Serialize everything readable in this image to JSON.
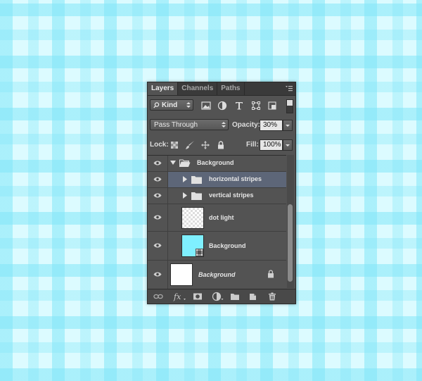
{
  "tabs": [
    {
      "label": "Layers",
      "active": true
    },
    {
      "label": "Channels",
      "active": false
    },
    {
      "label": "Paths",
      "active": false
    }
  ],
  "filter": {
    "kind_label": "Kind",
    "icons": [
      "image-filter-icon",
      "adjustment-filter-icon",
      "type-filter-icon",
      "shape-filter-icon",
      "smart-object-filter-icon",
      "filter-toggle-icon"
    ]
  },
  "blend": {
    "mode": "Pass Through",
    "opacity_label": "Opacity:",
    "opacity_value": "30%"
  },
  "lock": {
    "label": "Lock:",
    "icons": [
      "lock-transparent-icon",
      "lock-image-icon",
      "lock-position-icon",
      "lock-all-icon"
    ],
    "fill_label": "Fill:",
    "fill_value": "100%"
  },
  "layers": [
    {
      "name": "Background",
      "type": "group",
      "expanded": true,
      "indent": 0,
      "selected": false
    },
    {
      "name": "horizontal stripes",
      "type": "group",
      "expanded": false,
      "indent": 1,
      "selected": true
    },
    {
      "name": "vertical stripes",
      "type": "group",
      "expanded": false,
      "indent": 1,
      "selected": false
    },
    {
      "name": "dot light",
      "type": "layer",
      "thumb": "transparent",
      "indent": 1,
      "selected": false
    },
    {
      "name": "Background",
      "type": "layer",
      "thumb": "#7ff0ff",
      "smart_object": true,
      "indent": 1,
      "selected": false
    },
    {
      "name": "Background",
      "type": "background",
      "thumb": "#ffffff",
      "italic": true,
      "locked": true,
      "indent": 0,
      "selected": false
    }
  ],
  "bottom_icons": [
    "link-layers-icon",
    "fx-icon",
    "add-mask-icon",
    "new-adjustment-icon",
    "new-group-icon",
    "new-layer-icon",
    "delete-layer-icon"
  ],
  "colors": {
    "panel_bg": "#535353",
    "selected_row": "#5d6678",
    "canvas_stripe": "#82e6f8"
  }
}
